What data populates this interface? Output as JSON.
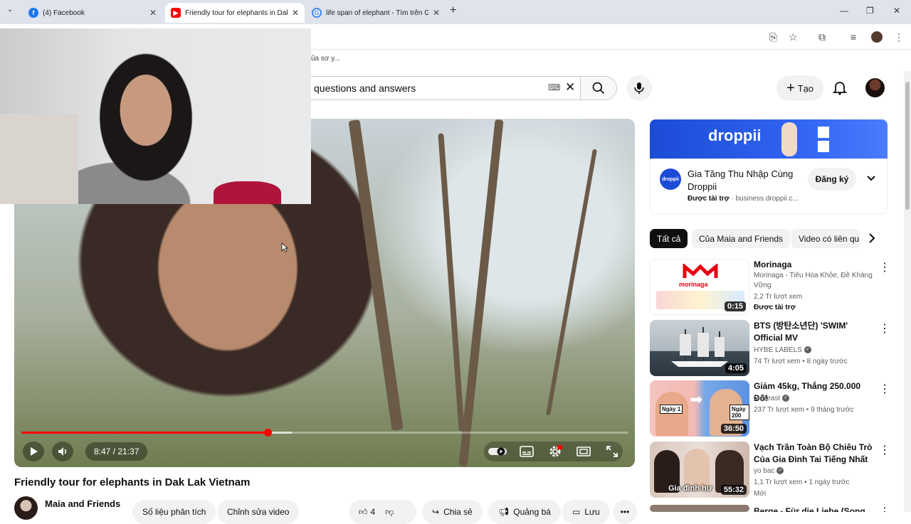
{
  "browser": {
    "tabs": [
      {
        "title": "(4) Facebook",
        "icon": "facebook-icon"
      },
      {
        "title": "Friendly tour for elephants in Dak",
        "icon": "youtube-icon"
      },
      {
        "title": "life span of elephant - Tìm trên Go",
        "icon": "google-icon"
      }
    ],
    "bookmark_text": "ủa sơ y..."
  },
  "header": {
    "search_value": "questions and answers",
    "create_label": "Tạo"
  },
  "player": {
    "time_current": "8:47",
    "time_total": "21:37",
    "time_display": "8:47 / 21:37",
    "progress": 0.4057
  },
  "video": {
    "title": "Friendly tour for elephants in Dak Lak Vietnam",
    "channel": "Maia and Friends",
    "buttons": {
      "analytics": "Số liệu phân tích",
      "edit": "Chỉnh sửa video",
      "likes": "4",
      "share": "Chia sẻ",
      "promote": "Quảng bá",
      "save": "Lưu"
    }
  },
  "ad": {
    "brand": "droppii",
    "title": "Gia Tăng Thu Nhập Cùng Droppii",
    "sponsored": "Được tài trợ",
    "domain": "business.droppii.c...",
    "subscribe": "Đăng ký"
  },
  "chips": [
    "Tất cả",
    "Của Maia and Friends",
    "Video có liên qu"
  ],
  "recommendations": [
    {
      "title": "Morinaga",
      "lines": [
        "Morinaga - Tiêu Hóa Khỏe, Đề Kháng Vững",
        "2,2 Tr lượt xem"
      ],
      "badge": "Được tài trợ",
      "duration": "0:15"
    },
    {
      "title": "BTS (방탄소년단) 'SWIM' Official MV",
      "channel": "HYBE LABELS",
      "stats": "74 Tr lượt xem • 8 ngày trước",
      "duration": "4:05"
    },
    {
      "title": "Giảm 45kg, Thắng 250.000 Đô!",
      "channel": "MrBeast",
      "stats": "237 Tr lượt xem • 9 tháng trước",
      "duration": "36:50",
      "thumb_text_left": "Ngày 1",
      "thumb_text_right": "Ngày 200"
    },
    {
      "title": "Vạch Trần Toàn Bộ Chiêu Trò Của Gia Đình Tai Tiếng Nhất C...",
      "channel": "yo bac",
      "stats": "1,1 Tr lượt xem • 1 ngày trước",
      "badge": "Mới",
      "duration": "55:32",
      "thumb_text": "Gia đình hư"
    },
    {
      "title": "Berge - Für die Liebe (Song für..."
    }
  ],
  "morinaga_logo": "morinaga",
  "colors": {
    "youtube_red": "#ff0000",
    "droppii_blue": "#1c4bd6"
  }
}
